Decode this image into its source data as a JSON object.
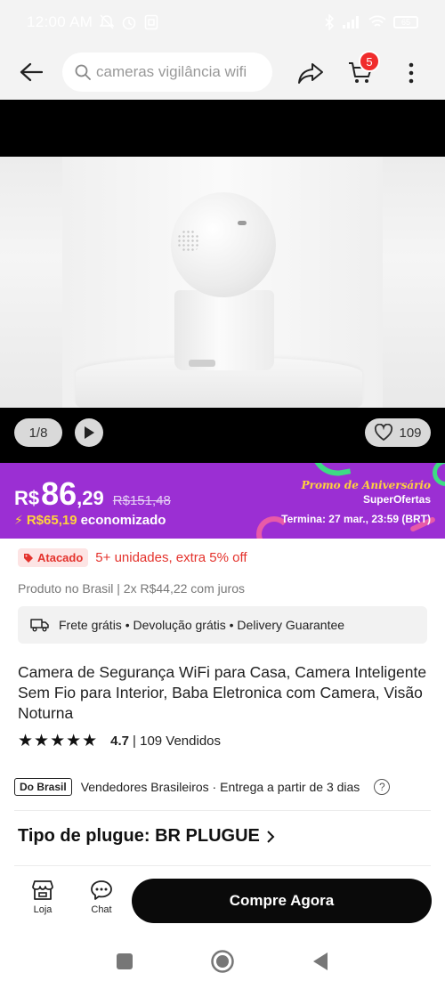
{
  "status_bar": {
    "time": "12:00 AM",
    "battery": "65"
  },
  "search": {
    "placeholder": "cameras vigilância wifi"
  },
  "cart": {
    "count": "5"
  },
  "gallery": {
    "pager": "1/8",
    "likes": "109"
  },
  "price": {
    "currency": "R$",
    "integer": "86",
    "decimal": ",29",
    "old_price": "R$151,48",
    "saved_amount": "R$65,19",
    "saved_label": "economizado",
    "promo_title": "Promo de Aniversário",
    "promo_sub": "SuperOfertas",
    "promo_end": "Termina: 27 mar., 23:59 (BRT)"
  },
  "wholesale": {
    "tag": "Atacado",
    "text": "5+ unidades, extra 5% off"
  },
  "origin_line": "Produto no Brasil | 2x R$44,22 com juros",
  "shipping": {
    "text": "Frete grátis • Devolução grátis • Delivery Guarantee"
  },
  "product": {
    "title": "Camera de Segurança WiFi para Casa, Camera Inteligente Sem Fio para Interior, Baba Eletronica com Camera, Visão Noturna",
    "stars": "★★★★★",
    "rating": "4.7",
    "sold": "| 109 Vendidos"
  },
  "brasil": {
    "badge": "Do Brasil",
    "text": "Vendedores Brasileiros · Entrega a partir de 3 dias",
    "help": "?"
  },
  "plug": {
    "label": "Tipo de plugue: BR PLUGUE"
  },
  "bottom_bar": {
    "store_label": "Loja",
    "chat_label": "Chat",
    "buy_label": "Compre Agora"
  },
  "colors": {
    "banner": "#9b2fd3",
    "accent_red": "#e4322c",
    "highlight_yellow": "#ffd23c"
  }
}
